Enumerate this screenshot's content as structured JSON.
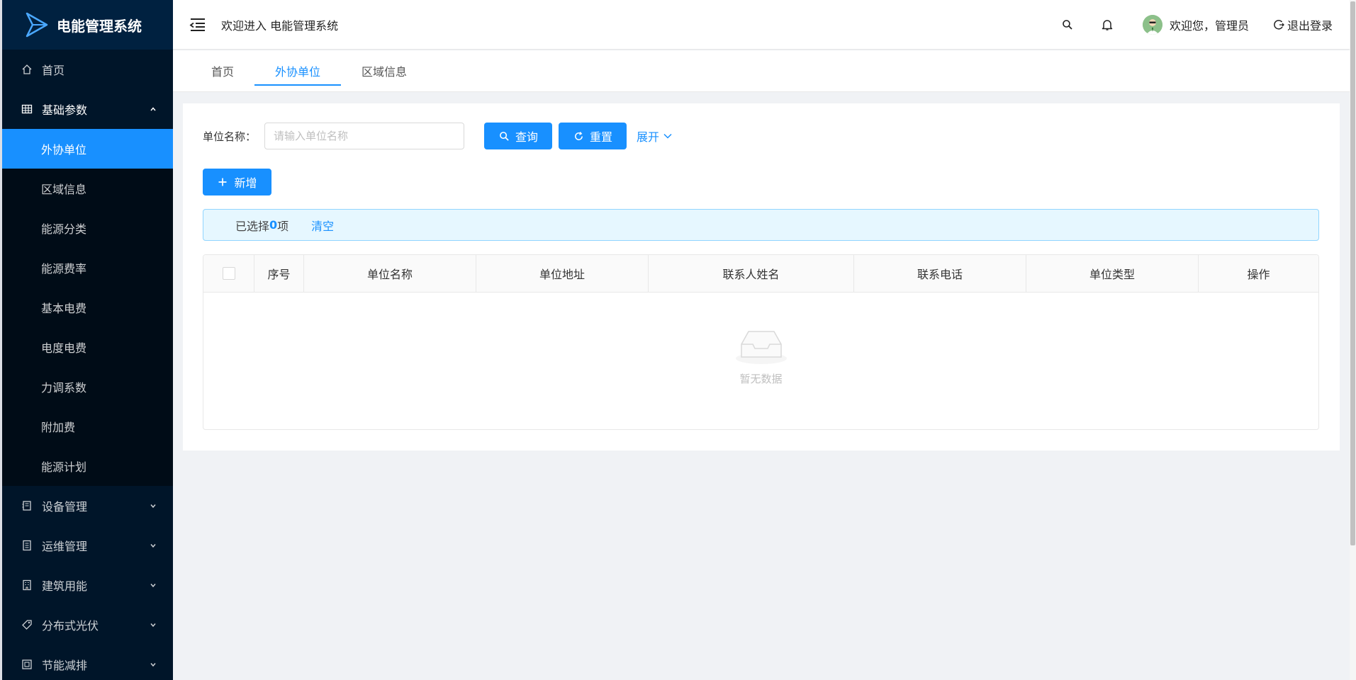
{
  "app": {
    "title": "电能管理系统"
  },
  "sidebar": {
    "items": [
      {
        "label": "首页",
        "icon": "home-icon"
      },
      {
        "label": "基础参数",
        "icon": "table-icon",
        "expanded": true,
        "children": [
          "外协单位",
          "区域信息",
          "能源分类",
          "能源费率",
          "基本电费",
          "电度电费",
          "力调系数",
          "附加费",
          "能源计划"
        ],
        "active_child": "外协单位"
      },
      {
        "label": "设备管理",
        "icon": "device-icon"
      },
      {
        "label": "运维管理",
        "icon": "document-icon"
      },
      {
        "label": "建筑用能",
        "icon": "building-icon"
      },
      {
        "label": "分布式光伏",
        "icon": "tag-icon"
      },
      {
        "label": "节能减排",
        "icon": "container-icon"
      }
    ]
  },
  "header": {
    "welcome": "欢迎进入 电能管理系统",
    "user": "欢迎您，管理员",
    "logout": "退出登录"
  },
  "tabs": [
    {
      "label": "首页",
      "active": false
    },
    {
      "label": "外协单位",
      "active": true
    },
    {
      "label": "区域信息",
      "active": false
    }
  ],
  "search": {
    "label": "单位名称：",
    "placeholder": "请输入单位名称",
    "value": "",
    "query_label": "查询",
    "reset_label": "重置",
    "expand_label": "展开"
  },
  "toolbar": {
    "add_label": "新增"
  },
  "selection": {
    "prefix": "已选择",
    "count": "0",
    "suffix": "项",
    "clear_label": "清空"
  },
  "table": {
    "columns": [
      "序号",
      "单位名称",
      "单位地址",
      "联系人姓名",
      "联系电话",
      "单位类型",
      "操作"
    ],
    "rows": [],
    "empty_text": "暂无数据"
  },
  "colors": {
    "primary": "#1890ff",
    "sidebar_bg": "#001529",
    "submenu_bg": "#000c17"
  }
}
